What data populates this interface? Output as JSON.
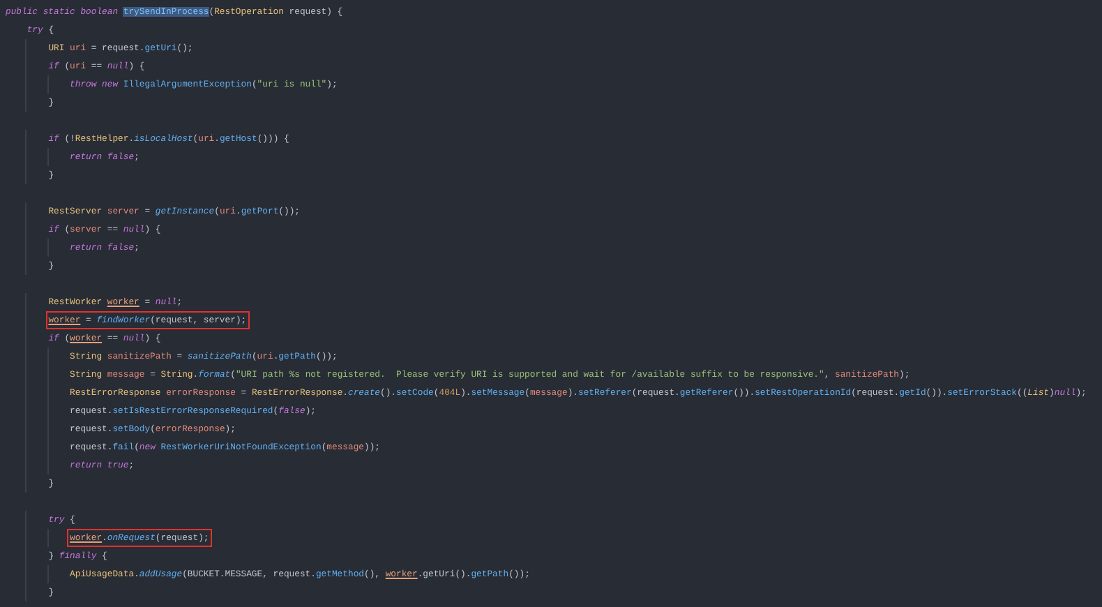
{
  "editor": {
    "lines": [
      {
        "kind": "code",
        "boxed": false,
        "code": [
          {
            "kind": "k",
            "text": "public static boolean "
          },
          {
            "kind": "sel",
            "text": "trySendInProcess"
          },
          {
            "kind": "p",
            "text": "("
          },
          {
            "kind": "t",
            "text": "RestOperation"
          },
          {
            "kind": "p",
            "text": " request) {"
          }
        ]
      },
      {
        "kind": "code",
        "boxed": false,
        "code": [
          {
            "kind": "k",
            "text": "    try"
          },
          {
            "kind": "p",
            "text": " {"
          }
        ]
      },
      {
        "kind": "code",
        "boxed": false,
        "code": [
          {
            "kind": "t",
            "text": "        URI"
          },
          {
            "kind": "v",
            "text": " uri"
          },
          {
            "kind": "p",
            "text": " = request."
          },
          {
            "kind": "f",
            "text": "getUri"
          },
          {
            "kind": "p",
            "text": "();"
          }
        ]
      },
      {
        "kind": "code",
        "boxed": false,
        "code": [
          {
            "kind": "k",
            "text": "        if"
          },
          {
            "kind": "p",
            "text": " ("
          },
          {
            "kind": "v",
            "text": "uri"
          },
          {
            "kind": "p",
            "text": " == "
          },
          {
            "kind": "k",
            "text": "null"
          },
          {
            "kind": "p",
            "text": ") {"
          }
        ]
      },
      {
        "kind": "code",
        "boxed": false,
        "code": [
          {
            "kind": "k",
            "text": "            throw new "
          },
          {
            "kind": "f",
            "text": "IllegalArgumentException"
          },
          {
            "kind": "p",
            "text": "("
          },
          {
            "kind": "s",
            "text": "\"uri is null\""
          },
          {
            "kind": "p",
            "text": ");"
          }
        ]
      },
      {
        "kind": "code",
        "boxed": false,
        "code": [
          {
            "kind": "p",
            "text": "        }"
          }
        ]
      },
      {
        "kind": "blank"
      },
      {
        "kind": "code",
        "boxed": false,
        "code": [
          {
            "kind": "k",
            "text": "        if"
          },
          {
            "kind": "p",
            "text": " (!"
          },
          {
            "kind": "t",
            "text": "RestHelper"
          },
          {
            "kind": "p",
            "text": "."
          },
          {
            "kind": "fi",
            "text": "isLocalHost"
          },
          {
            "kind": "p",
            "text": "("
          },
          {
            "kind": "v",
            "text": "uri"
          },
          {
            "kind": "p",
            "text": "."
          },
          {
            "kind": "f",
            "text": "getHost"
          },
          {
            "kind": "p",
            "text": "())) {"
          }
        ]
      },
      {
        "kind": "code",
        "boxed": false,
        "code": [
          {
            "kind": "k",
            "text": "            return false"
          },
          {
            "kind": "p",
            "text": ";"
          }
        ]
      },
      {
        "kind": "code",
        "boxed": false,
        "code": [
          {
            "kind": "p",
            "text": "        }"
          }
        ]
      },
      {
        "kind": "blank"
      },
      {
        "kind": "code",
        "boxed": false,
        "code": [
          {
            "kind": "t",
            "text": "        RestServer"
          },
          {
            "kind": "v",
            "text": " server"
          },
          {
            "kind": "p",
            "text": " = "
          },
          {
            "kind": "fi",
            "text": "getInstance"
          },
          {
            "kind": "p",
            "text": "("
          },
          {
            "kind": "v",
            "text": "uri"
          },
          {
            "kind": "p",
            "text": "."
          },
          {
            "kind": "f",
            "text": "getPort"
          },
          {
            "kind": "p",
            "text": "());"
          }
        ]
      },
      {
        "kind": "code",
        "boxed": false,
        "code": [
          {
            "kind": "k",
            "text": "        if"
          },
          {
            "kind": "p",
            "text": " ("
          },
          {
            "kind": "v",
            "text": "server"
          },
          {
            "kind": "p",
            "text": " == "
          },
          {
            "kind": "k",
            "text": "null"
          },
          {
            "kind": "p",
            "text": ") {"
          }
        ]
      },
      {
        "kind": "code",
        "boxed": false,
        "code": [
          {
            "kind": "k",
            "text": "            return false"
          },
          {
            "kind": "p",
            "text": ";"
          }
        ]
      },
      {
        "kind": "code",
        "boxed": false,
        "code": [
          {
            "kind": "p",
            "text": "        }"
          }
        ]
      },
      {
        "kind": "blank"
      },
      {
        "kind": "code",
        "boxed": false,
        "code": [
          {
            "kind": "t",
            "text": "        RestWorker "
          },
          {
            "kind": "u",
            "text": "worker"
          },
          {
            "kind": "p",
            "text": " = "
          },
          {
            "kind": "k",
            "text": "null"
          },
          {
            "kind": "p",
            "text": ";"
          }
        ]
      },
      {
        "kind": "code",
        "boxed": true,
        "code": [
          {
            "kind": "u",
            "text": "        worker"
          },
          {
            "kind": "p",
            "text": " = "
          },
          {
            "kind": "fi",
            "text": "findWorker"
          },
          {
            "kind": "p",
            "text": "(request, server);"
          }
        ]
      },
      {
        "kind": "code",
        "boxed": false,
        "code": [
          {
            "kind": "k",
            "text": "        if"
          },
          {
            "kind": "p",
            "text": " ("
          },
          {
            "kind": "u",
            "text": "worker"
          },
          {
            "kind": "p",
            "text": " == "
          },
          {
            "kind": "k",
            "text": "null"
          },
          {
            "kind": "p",
            "text": ") {"
          }
        ]
      },
      {
        "kind": "code",
        "boxed": false,
        "code": [
          {
            "kind": "t",
            "text": "            String"
          },
          {
            "kind": "v",
            "text": " sanitizePath"
          },
          {
            "kind": "p",
            "text": " = "
          },
          {
            "kind": "fi",
            "text": "sanitizePath"
          },
          {
            "kind": "p",
            "text": "("
          },
          {
            "kind": "v",
            "text": "uri"
          },
          {
            "kind": "p",
            "text": "."
          },
          {
            "kind": "f",
            "text": "getPath"
          },
          {
            "kind": "p",
            "text": "());"
          }
        ]
      },
      {
        "kind": "code",
        "boxed": false,
        "code": [
          {
            "kind": "t",
            "text": "            String"
          },
          {
            "kind": "v",
            "text": " message"
          },
          {
            "kind": "p",
            "text": " = "
          },
          {
            "kind": "t",
            "text": "String"
          },
          {
            "kind": "p",
            "text": "."
          },
          {
            "kind": "fi",
            "text": "format"
          },
          {
            "kind": "p",
            "text": "("
          },
          {
            "kind": "s",
            "text": "\"URI path %s not registered.  Please verify URI is supported and wait for /available suffix to be responsive.\""
          },
          {
            "kind": "p",
            "text": ", "
          },
          {
            "kind": "v",
            "text": "sanitizePath"
          },
          {
            "kind": "p",
            "text": ");"
          }
        ]
      },
      {
        "kind": "code",
        "boxed": false,
        "code": [
          {
            "kind": "t",
            "text": "            RestErrorResponse"
          },
          {
            "kind": "v",
            "text": " errorResponse"
          },
          {
            "kind": "p",
            "text": " = "
          },
          {
            "kind": "t",
            "text": "RestErrorResponse"
          },
          {
            "kind": "p",
            "text": "."
          },
          {
            "kind": "fi",
            "text": "create"
          },
          {
            "kind": "p",
            "text": "()."
          },
          {
            "kind": "f",
            "text": "setCode"
          },
          {
            "kind": "p",
            "text": "("
          },
          {
            "kind": "n",
            "text": "404L"
          },
          {
            "kind": "p",
            "text": ")."
          },
          {
            "kind": "f",
            "text": "setMessage"
          },
          {
            "kind": "p",
            "text": "("
          },
          {
            "kind": "v",
            "text": "message"
          },
          {
            "kind": "p",
            "text": ")."
          },
          {
            "kind": "f",
            "text": "setReferer"
          },
          {
            "kind": "p",
            "text": "(request."
          },
          {
            "kind": "f",
            "text": "getReferer"
          },
          {
            "kind": "p",
            "text": "())."
          },
          {
            "kind": "f",
            "text": "setRestOperationId"
          },
          {
            "kind": "p",
            "text": "(request."
          },
          {
            "kind": "f",
            "text": "getId"
          },
          {
            "kind": "p",
            "text": "())."
          },
          {
            "kind": "f",
            "text": "setErrorStack"
          },
          {
            "kind": "p",
            "text": "(("
          },
          {
            "kind": "ti",
            "text": "List"
          },
          {
            "kind": "p",
            "text": ")"
          },
          {
            "kind": "k",
            "text": "null"
          },
          {
            "kind": "p",
            "text": ");"
          }
        ]
      },
      {
        "kind": "code",
        "boxed": false,
        "code": [
          {
            "kind": "p",
            "text": "            request."
          },
          {
            "kind": "f",
            "text": "setIsRestErrorResponseRequired"
          },
          {
            "kind": "p",
            "text": "("
          },
          {
            "kind": "k",
            "text": "false"
          },
          {
            "kind": "p",
            "text": ");"
          }
        ]
      },
      {
        "kind": "code",
        "boxed": false,
        "code": [
          {
            "kind": "p",
            "text": "            request."
          },
          {
            "kind": "f",
            "text": "setBody"
          },
          {
            "kind": "p",
            "text": "("
          },
          {
            "kind": "v",
            "text": "errorResponse"
          },
          {
            "kind": "p",
            "text": ");"
          }
        ]
      },
      {
        "kind": "code",
        "boxed": false,
        "code": [
          {
            "kind": "p",
            "text": "            request."
          },
          {
            "kind": "f",
            "text": "fail"
          },
          {
            "kind": "p",
            "text": "("
          },
          {
            "kind": "k",
            "text": "new "
          },
          {
            "kind": "f",
            "text": "RestWorkerUriNotFoundException"
          },
          {
            "kind": "p",
            "text": "("
          },
          {
            "kind": "v",
            "text": "message"
          },
          {
            "kind": "p",
            "text": "));"
          }
        ]
      },
      {
        "kind": "code",
        "boxed": false,
        "code": [
          {
            "kind": "k",
            "text": "            return true"
          },
          {
            "kind": "p",
            "text": ";"
          }
        ]
      },
      {
        "kind": "code",
        "boxed": false,
        "code": [
          {
            "kind": "p",
            "text": "        }"
          }
        ]
      },
      {
        "kind": "blank"
      },
      {
        "kind": "code",
        "boxed": false,
        "code": [
          {
            "kind": "k",
            "text": "        try"
          },
          {
            "kind": "p",
            "text": " {"
          }
        ]
      },
      {
        "kind": "code",
        "boxed": true,
        "code": [
          {
            "kind": "u",
            "text": "            worker"
          },
          {
            "kind": "p",
            "text": "."
          },
          {
            "kind": "fi",
            "text": "onRequest"
          },
          {
            "kind": "p",
            "text": "(request);"
          }
        ]
      },
      {
        "kind": "code",
        "boxed": false,
        "code": [
          {
            "kind": "p",
            "text": "        } "
          },
          {
            "kind": "k",
            "text": "finally"
          },
          {
            "kind": "p",
            "text": " {"
          }
        ]
      },
      {
        "kind": "code",
        "boxed": false,
        "code": [
          {
            "kind": "t",
            "text": "            ApiUsageData."
          },
          {
            "kind": "fi",
            "text": "addUsage"
          },
          {
            "kind": "p",
            "text": "(BUCKET.MESSAGE, request."
          },
          {
            "kind": "f",
            "text": "getMethod"
          },
          {
            "kind": "p",
            "text": "(), "
          },
          {
            "kind": "u",
            "text": "worker"
          },
          {
            "kind": "p",
            "text": ".getUri"
          },
          {
            "kind": "p",
            "text": "()."
          },
          {
            "kind": "f",
            "text": "getPath"
          },
          {
            "kind": "p",
            "text": "());"
          }
        ]
      },
      {
        "kind": "code",
        "boxed": false,
        "code": [
          {
            "kind": "p",
            "text": "        }"
          }
        ]
      }
    ]
  }
}
